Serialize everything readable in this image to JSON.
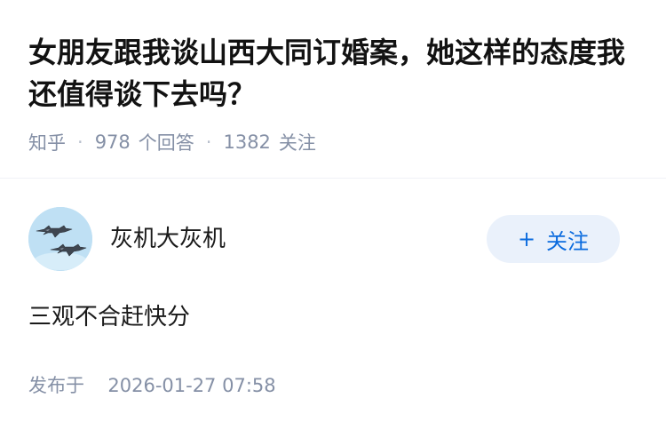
{
  "question": {
    "title": "女朋友跟我谈山西大同订婚案，她这样的态度我还值得谈下去吗？",
    "source": "知乎",
    "answer_count": "978",
    "answer_count_label": "个回答",
    "follower_count": "1382",
    "follower_count_label": "关注",
    "separator": "·"
  },
  "answer": {
    "author": {
      "name": "灰机大灰机",
      "avatar_icon": "fighter-jets-icon",
      "avatar_bg": "#bfe0f4"
    },
    "follow_button": {
      "plus": "+",
      "label": "关注"
    },
    "content": "三观不合赶快分",
    "published": {
      "label": "发布于",
      "time": "2026-01-27 07:58"
    }
  },
  "colors": {
    "title": "#121212",
    "meta": "#8590a6",
    "accent": "#0b6bde",
    "button_bg": "#eaf1fb",
    "divider": "#f0f2f7"
  }
}
